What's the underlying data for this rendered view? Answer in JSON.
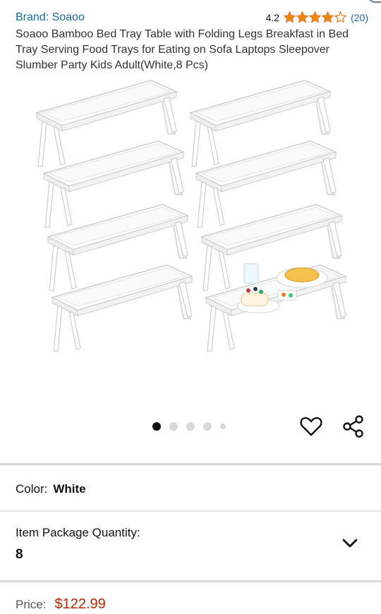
{
  "brand": {
    "text": "Brand: Soaoo"
  },
  "rating": {
    "value": "4.2",
    "stars": 4.2,
    "max_stars": 5,
    "count": "(20)",
    "star_color": "#f08804"
  },
  "product": {
    "title": "Soaoo Bamboo Bed Tray Table with Folding Legs Breakfast in Bed Tray Serving Food Trays for Eating on Sofa Laptops Sleepover Slumber Party Kids Adult(White,8 Pcs)"
  },
  "gallery": {
    "image_count": 5,
    "active_index": 0,
    "heart_icon": "heart-icon",
    "share_icon": "share-icon"
  },
  "color": {
    "label": "Color:",
    "value": "White"
  },
  "quantity": {
    "label": "Item Package Quantity:",
    "value": "8",
    "icon": "chevron-down-icon"
  },
  "price": {
    "label": "Price:",
    "value": "$122.99",
    "color": "#b12704"
  },
  "theme": {
    "link_color": "#1a6a96",
    "divider": "#d5d9d9"
  }
}
